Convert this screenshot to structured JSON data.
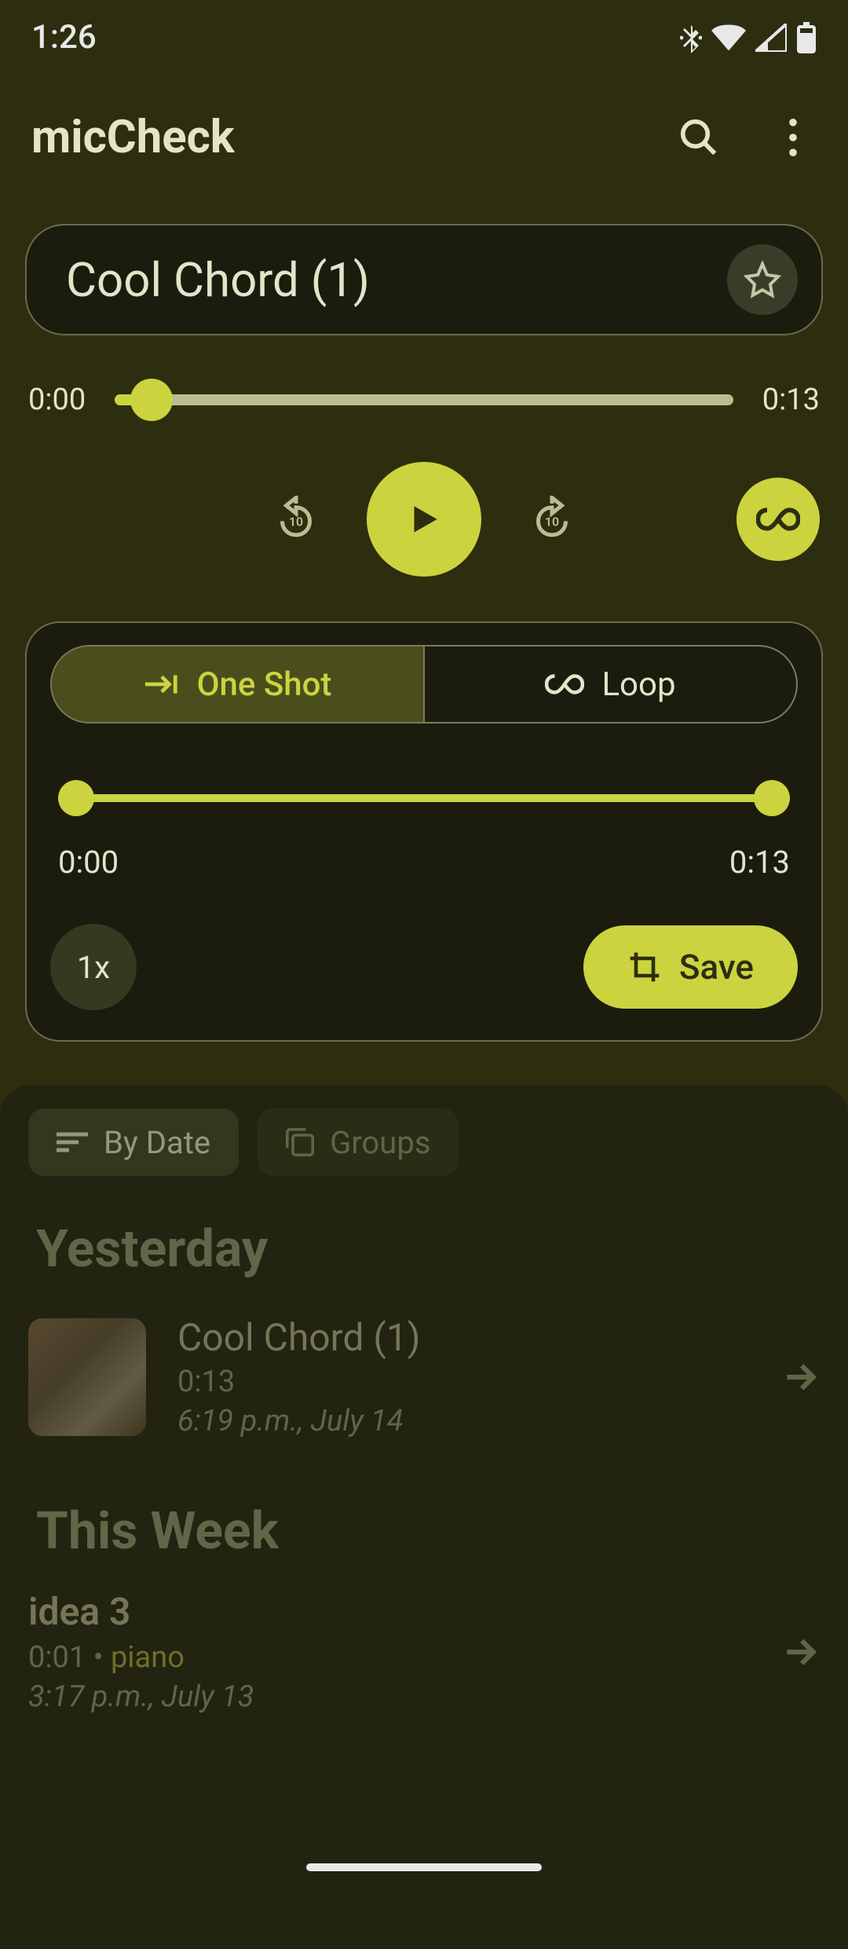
{
  "status": {
    "time": "1:26"
  },
  "appbar": {
    "title": "micCheck"
  },
  "track": {
    "title": "Cool Chord (1)",
    "current_time": "0:00",
    "duration": "0:13"
  },
  "mode": {
    "one_shot": "One Shot",
    "loop": "Loop",
    "range_start": "0:00",
    "range_end": "0:13",
    "speed": "1x",
    "save": "Save"
  },
  "chips": {
    "by_date": "By Date",
    "groups": "Groups"
  },
  "sections": [
    {
      "header": "Yesterday",
      "items": [
        {
          "title": "Cool Chord (1)",
          "duration": "0:13",
          "date": "6:19 p.m., July 14",
          "has_thumb": true
        }
      ]
    },
    {
      "header": "This Week",
      "items": [
        {
          "title": "idea 3",
          "duration": "0:01",
          "tag": "piano",
          "date": "3:17 p.m., July 13",
          "has_thumb": false
        }
      ]
    }
  ]
}
